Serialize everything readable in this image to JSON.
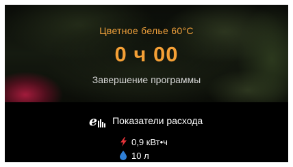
{
  "program": {
    "name": "Цветное белье 60°C",
    "remaining_time": "0 ч 00",
    "status": "Завершение программы"
  },
  "consumption": {
    "title": "Показатели расхода",
    "energy": "0,9 кВт•ч",
    "water": "10 л",
    "icons": {
      "header": "eco-consumption-icon",
      "energy": "lightning-icon",
      "water": "water-drop-icon"
    }
  },
  "colors": {
    "accent": "#f5a036",
    "energy_icon": "#e8333a",
    "water_icon": "#2f7fd6",
    "background": "#000000"
  }
}
